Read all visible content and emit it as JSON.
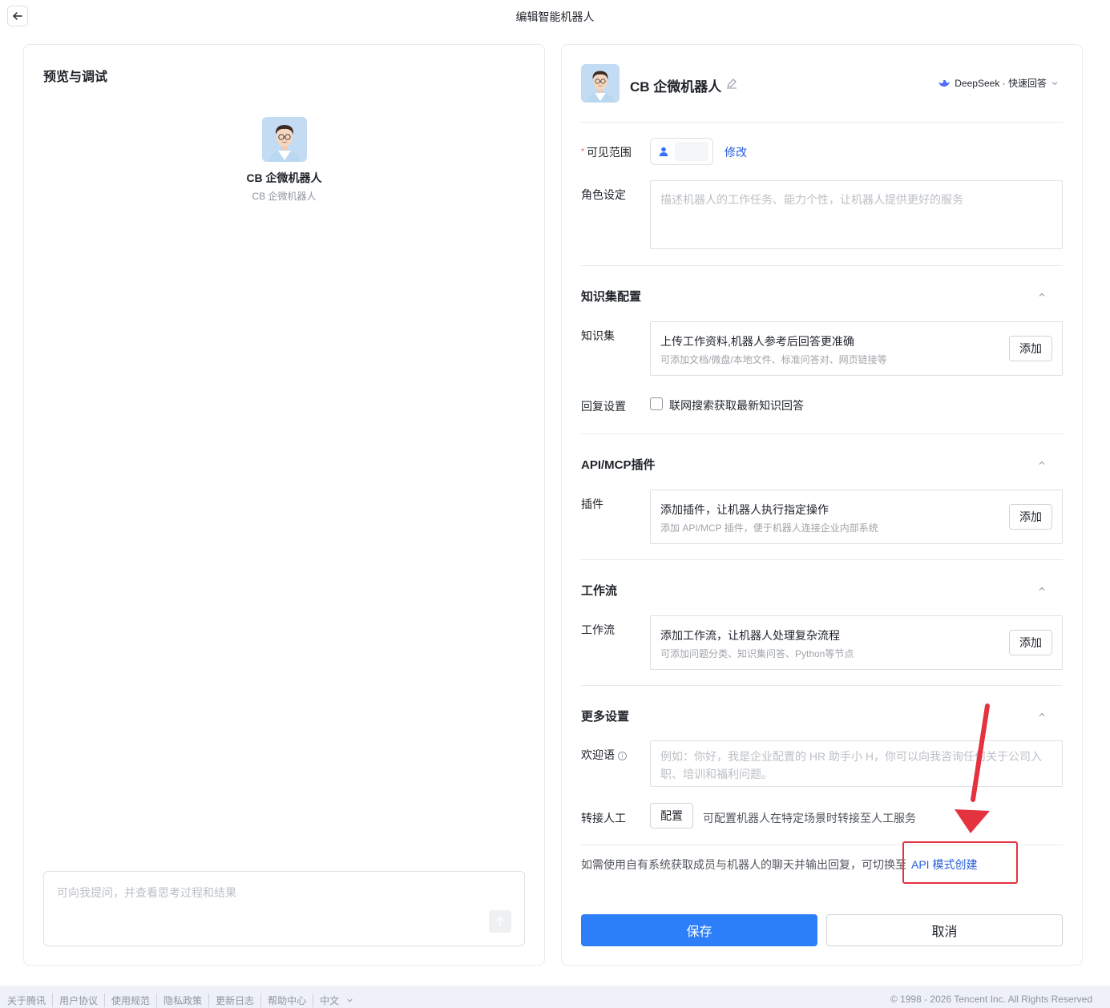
{
  "header": {
    "title": "编辑智能机器人"
  },
  "preview": {
    "title": "预览与调试",
    "bot_name": "CB 企微机器人",
    "bot_subtitle": "CB 企微机器人",
    "input_placeholder": "可向我提问，并查看思考过程和结果"
  },
  "editor": {
    "bot_name": "CB 企微机器人",
    "model_label": "DeepSeek · 快速回答",
    "visibility": {
      "required_mark": "*",
      "label": "可见范围",
      "modify": "修改"
    },
    "role": {
      "label": "角色设定",
      "placeholder": "描述机器人的工作任务、能力个性，让机器人提供更好的服务"
    },
    "knowledge": {
      "section_title": "知识集配置",
      "label": "知识集",
      "card_title": "上传工作资料,机器人参考后回答更准确",
      "card_sub": "可添加文档/微盘/本地文件、标准问答对、网页链接等",
      "add": "添加",
      "reply_label": "回复设置",
      "reply_option": "联网搜索获取最新知识回答"
    },
    "plugins": {
      "section_title": "API/MCP插件",
      "label": "插件",
      "card_title": "添加插件，让机器人执行指定操作",
      "card_sub": "添加 API/MCP 插件，便于机器人连接企业内部系统",
      "add": "添加"
    },
    "workflow": {
      "section_title": "工作流",
      "label": "工作流",
      "card_title": "添加工作流，让机器人处理复杂流程",
      "card_sub": "可添加问题分类、知识集问答、Python等节点",
      "add": "添加"
    },
    "more": {
      "section_title": "更多设置",
      "welcome_label": "欢迎语",
      "welcome_placeholder": "例如：你好，我是企业配置的 HR 助手小 H，你可以向我咨询任何关于公司入职、培训和福利问题。",
      "transfer_label": "转接人工",
      "transfer_button": "配置",
      "transfer_desc": "可配置机器人在特定场景时转接至人工服务"
    },
    "api_hint": "如需使用自有系统获取成员与机器人的聊天并输出回复，可切换至",
    "api_link": "API 模式创建",
    "save": "保存",
    "cancel": "取消"
  },
  "footer": {
    "links": [
      "关于腾讯",
      "用户协议",
      "使用规范",
      "隐私政策",
      "更新日志",
      "帮助中心"
    ],
    "language": "中文",
    "copyright": "© 1998 - 2026 Tencent Inc. All Rights Reserved"
  },
  "colors": {
    "primary": "#2d7ff9",
    "link": "#245bdb",
    "annotation": "#e5323f"
  }
}
